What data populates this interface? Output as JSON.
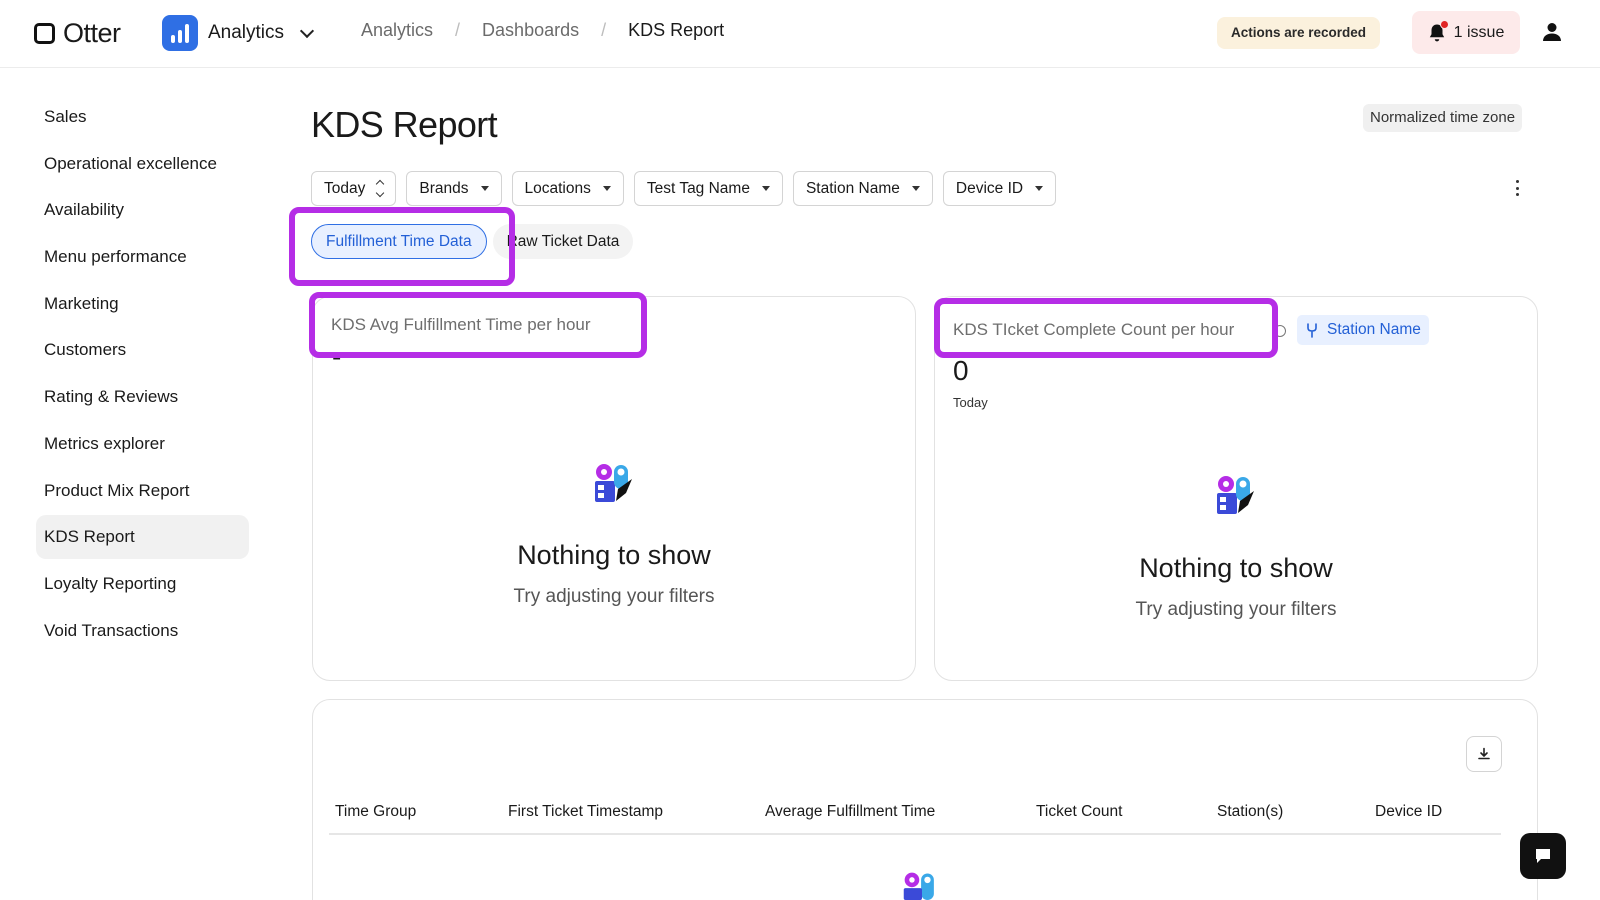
{
  "brand": {
    "name": "Otter"
  },
  "app_switcher": {
    "label": "Analytics"
  },
  "breadcrumb": [
    {
      "label": "Analytics"
    },
    {
      "label": "Dashboards"
    },
    {
      "label": "KDS Report"
    }
  ],
  "header": {
    "recorded_badge": "Actions are recorded",
    "issues_label": "1 issue"
  },
  "sidebar": {
    "items": [
      {
        "label": "Sales"
      },
      {
        "label": "Operational excellence"
      },
      {
        "label": "Availability"
      },
      {
        "label": "Menu performance"
      },
      {
        "label": "Marketing"
      },
      {
        "label": "Customers"
      },
      {
        "label": "Rating & Reviews"
      },
      {
        "label": "Metrics explorer"
      },
      {
        "label": "Product Mix Report"
      },
      {
        "label": "KDS Report",
        "active": true
      },
      {
        "label": "Loyalty Reporting"
      },
      {
        "label": "Void Transactions"
      }
    ]
  },
  "page": {
    "title": "KDS Report",
    "timezone_badge": "Normalized time zone"
  },
  "filters": [
    {
      "label": "Today"
    },
    {
      "label": "Brands"
    },
    {
      "label": "Locations"
    },
    {
      "label": "Test Tag Name"
    },
    {
      "label": "Station Name"
    },
    {
      "label": "Device ID"
    }
  ],
  "tabs": [
    {
      "label": "Fulfillment Time Data",
      "active": true
    },
    {
      "label": "Raw Ticket Data",
      "active": false
    }
  ],
  "cards": {
    "left": {
      "title": "KDS Avg Fulfillment Time per hour",
      "value": "-",
      "empty_title": "Nothing to show",
      "empty_sub": "Try adjusting your filters"
    },
    "right": {
      "title": "KDS TIcket Complete Count per hour",
      "chip": "Station Name",
      "value": "0",
      "period": "Today",
      "empty_title": "Nothing to show",
      "empty_sub": "Try adjusting your filters"
    }
  },
  "table": {
    "columns": [
      {
        "label": "Time Group"
      },
      {
        "label": "First Ticket Timestamp"
      },
      {
        "label": "Average Fulfillment Time"
      },
      {
        "label": "Ticket Count"
      },
      {
        "label": "Station(s)"
      },
      {
        "label": "Device ID"
      }
    ]
  },
  "colors": {
    "accent": "#2f6fe4",
    "highlight": "#b52de6",
    "recorded_bg": "#fbf1dd",
    "issue_bg": "#fdeaea"
  }
}
